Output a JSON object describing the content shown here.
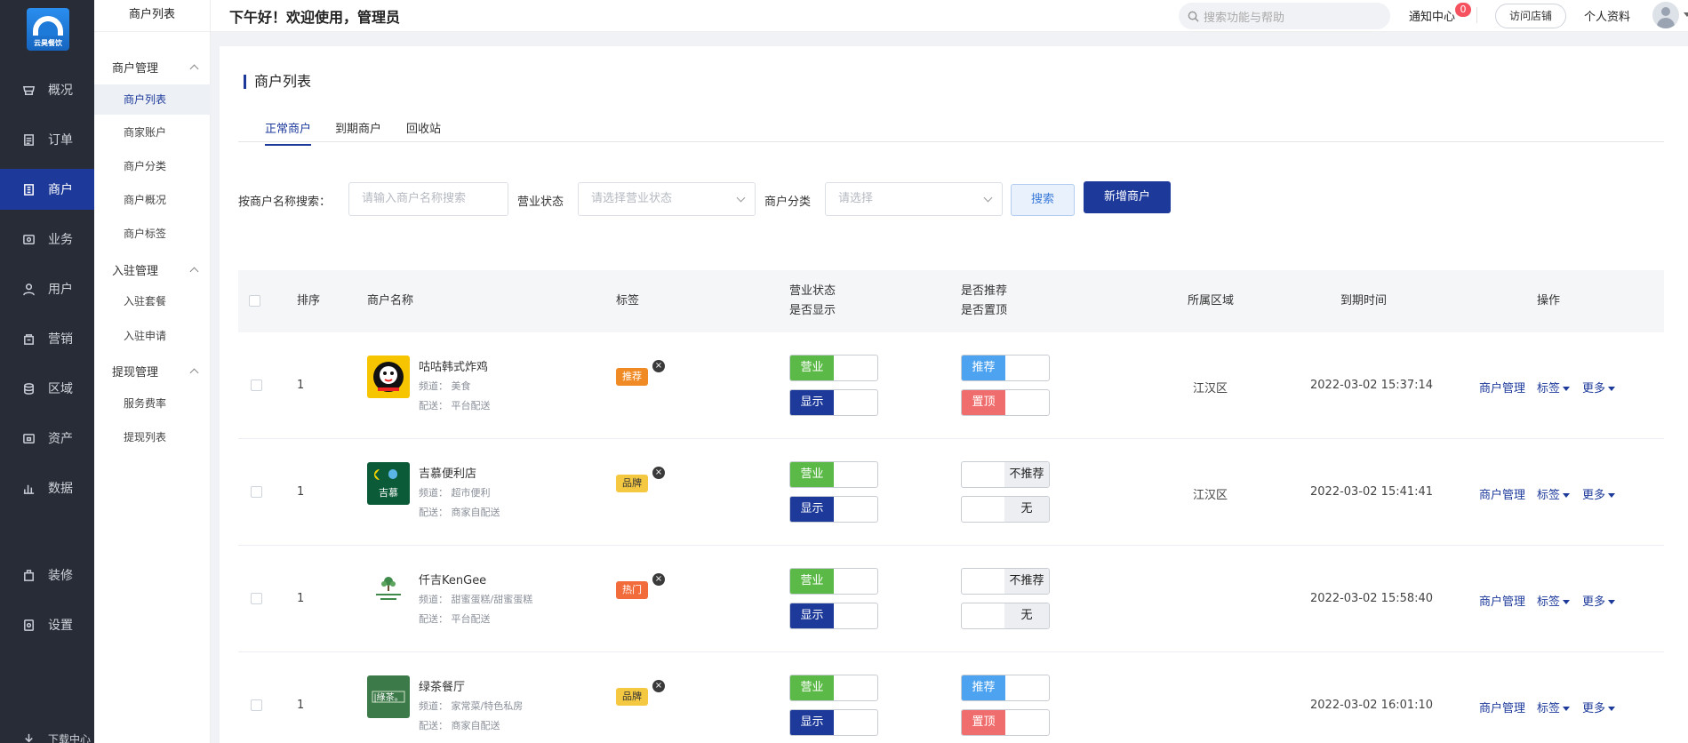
{
  "brand": {
    "logo_text": "云昊餐饮",
    "accent": "#1d3a9b"
  },
  "nav": [
    {
      "label": "概况",
      "icon": "shop-icon"
    },
    {
      "label": "订单",
      "icon": "order-icon"
    },
    {
      "label": "商户",
      "icon": "merchant-icon",
      "active": true
    },
    {
      "label": "业务",
      "icon": "business-icon"
    },
    {
      "label": "用户",
      "icon": "user-icon"
    },
    {
      "label": "营销",
      "icon": "marketing-icon"
    },
    {
      "label": "区域",
      "icon": "region-icon"
    },
    {
      "label": "资产",
      "icon": "asset-icon"
    },
    {
      "label": "数据",
      "icon": "chart-icon"
    },
    {
      "label": "装修",
      "icon": "decor-icon"
    },
    {
      "label": "设置",
      "icon": "settings-icon"
    },
    {
      "label": "下载中心",
      "icon": "download-icon"
    }
  ],
  "submenu": {
    "title": "商户列表",
    "groups": [
      {
        "label": "商户管理",
        "items": [
          "商户列表",
          "商家账户",
          "商户分类",
          "商户概况",
          "商户标签"
        ]
      },
      {
        "label": "入驻管理",
        "items": [
          "入驻套餐",
          "入驻申请"
        ]
      },
      {
        "label": "提现管理",
        "items": [
          "服务费率",
          "提现列表"
        ]
      }
    ]
  },
  "header": {
    "greeting": "下午好！欢迎使用，管理员",
    "search_placeholder": "搜索功能与帮助",
    "notice_label": "通知中心",
    "notice_count": "0",
    "visit_label": "访问店铺",
    "profile_label": "个人资料"
  },
  "page": {
    "title": "商户列表",
    "tabs": [
      "正常商户",
      "到期商户",
      "回收站"
    ],
    "filter": {
      "name_label": "按商户名称搜索：",
      "name_placeholder": "请输入商户名称搜索",
      "status_label": "营业状态",
      "status_placeholder": "请选择营业状态",
      "category_label": "商户分类",
      "category_placeholder": "请选择",
      "search_btn": "搜索",
      "new_btn": "新增商户"
    }
  },
  "table": {
    "headers": {
      "sort": "排序",
      "name": "商户名称",
      "tag": "标签",
      "status1": "营业状态",
      "status2": "是否显示",
      "rec1": "是否推荐",
      "rec2": "是否置顶",
      "area": "所属区域",
      "expire": "到期时间",
      "ops": "操作"
    },
    "ops": {
      "manage": "商户管理",
      "tag": "标签",
      "more": "更多"
    },
    "rows": [
      {
        "sort": "1",
        "name": "咕咕韩式炸鸡",
        "channel": "频道： 美食",
        "delivery": "配送： 平台配送",
        "tag": "推荐",
        "tag_color": "#f08a24",
        "open": "营业",
        "show": "显示",
        "rec": "推荐",
        "rec_on": true,
        "top": "置顶",
        "top_on": true,
        "area": "江汉区",
        "expire": "2022-03-02 15:37:14"
      },
      {
        "sort": "1",
        "name": "吉慕便利店",
        "channel": "频道： 超市便利",
        "delivery": "配送： 商家自配送",
        "tag": "品牌",
        "tag_color": "#f5c842",
        "open": "营业",
        "show": "显示",
        "rec": "不推荐",
        "rec_on": false,
        "top": "无",
        "top_on": false,
        "area": "江汉区",
        "expire": "2022-03-02 15:41:41"
      },
      {
        "sort": "1",
        "name": "仟吉KenGee",
        "channel": "频道： 甜蜜蛋糕/甜蜜蛋糕",
        "delivery": "配送： 平台配送",
        "tag": "热门",
        "tag_color": "#f26b3a",
        "open": "营业",
        "show": "显示",
        "rec": "不推荐",
        "rec_on": false,
        "top": "无",
        "top_on": false,
        "area": "",
        "expire": "2022-03-02 15:58:40"
      },
      {
        "sort": "1",
        "name": "绿茶餐厅",
        "channel": "频道： 家常菜/特色私房",
        "delivery": "配送： 商家自配送",
        "tag": "品牌",
        "tag_color": "#f5c842",
        "open": "营业",
        "show": "显示",
        "rec": "推荐",
        "rec_on": true,
        "top": "置顶",
        "top_on": true,
        "area": "",
        "expire": "2022-03-02 16:01:10"
      }
    ]
  }
}
